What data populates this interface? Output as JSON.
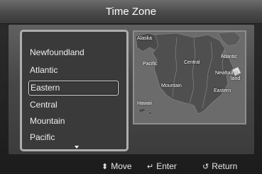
{
  "title": "Time Zone",
  "timezones": [
    "Newfoundland",
    "Atlantic",
    "Eastern",
    "Central",
    "Mountain",
    "Pacific"
  ],
  "selected_index": 2,
  "map_labels": {
    "alaska": "Alaska",
    "pacific": "Pacific",
    "central": "Central",
    "atlantic": "Atlantic",
    "newfoundland_line1": "Newfound-",
    "newfoundland_line2": "land",
    "mountain": "Mountain",
    "eastern": "Eastern",
    "hawaii": "Hawaii"
  },
  "footer": {
    "move_icon": "up-down-arrows-icon",
    "move_label": "Move",
    "enter_icon": "enter-icon",
    "enter_label": "Enter",
    "return_icon": "return-icon",
    "return_label": "Return"
  }
}
